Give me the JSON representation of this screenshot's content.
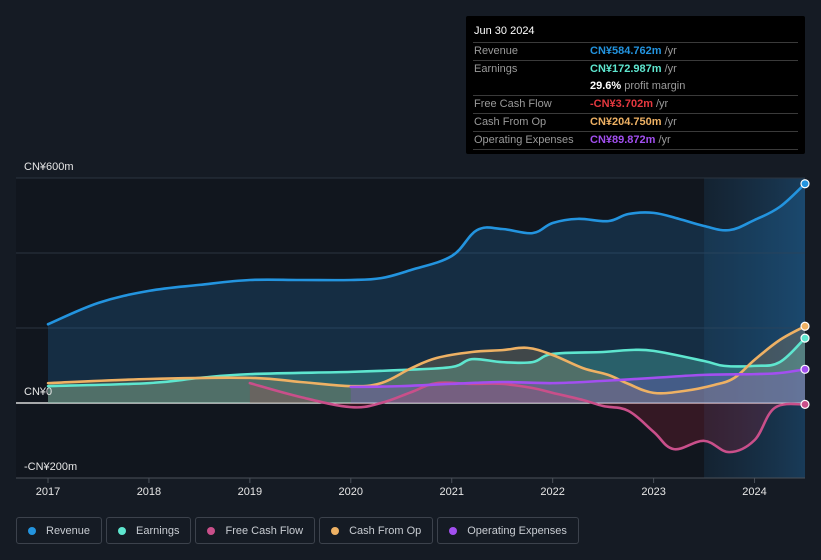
{
  "tooltip": {
    "date": "Jun 30 2024",
    "rows": [
      {
        "label": "Revenue",
        "value": "CN¥584.762m",
        "unit": "/yr",
        "color": "#2394df"
      },
      {
        "label": "Earnings",
        "value": "CN¥172.987m",
        "unit": "/yr",
        "color": "#5ee6cf"
      },
      {
        "label": "",
        "value": "29.6%",
        "unit": "profit margin",
        "color": "#ffffff"
      },
      {
        "label": "Free Cash Flow",
        "value": "-CN¥3.702m",
        "unit": "/yr",
        "color": "#e5383f"
      },
      {
        "label": "Cash From Op",
        "value": "CN¥204.750m",
        "unit": "/yr",
        "color": "#eeb164"
      },
      {
        "label": "Operating Expenses",
        "value": "CN¥89.872m",
        "unit": "/yr",
        "color": "#a24ff0"
      }
    ]
  },
  "legend": [
    {
      "label": "Revenue",
      "color": "#2394df"
    },
    {
      "label": "Earnings",
      "color": "#5ee6cf"
    },
    {
      "label": "Free Cash Flow",
      "color": "#c94f8a"
    },
    {
      "label": "Cash From Op",
      "color": "#eeb164"
    },
    {
      "label": "Operating Expenses",
      "color": "#a24ff0"
    }
  ],
  "chart_data": {
    "type": "area",
    "title": "",
    "xlabel": "",
    "ylabel": "",
    "ylim": [
      -200,
      600
    ],
    "xlim": [
      2017,
      2024.5
    ],
    "y_ticks": [
      {
        "value": 600,
        "label": "CN¥600m"
      },
      {
        "value": 0,
        "label": "CN¥0"
      },
      {
        "value": -200,
        "label": "-CN¥200m"
      }
    ],
    "x_ticks": [
      {
        "value": 2017,
        "label": "2017"
      },
      {
        "value": 2018,
        "label": "2018"
      },
      {
        "value": 2019,
        "label": "2019"
      },
      {
        "value": 2020,
        "label": "2020"
      },
      {
        "value": 2021,
        "label": "2021"
      },
      {
        "value": 2022,
        "label": "2022"
      },
      {
        "value": 2023,
        "label": "2023"
      },
      {
        "value": 2024,
        "label": "2024"
      }
    ],
    "grid": true,
    "highlight_range": [
      2023.5,
      2024.5
    ],
    "legend_position": "bottom-left",
    "series": [
      {
        "name": "Revenue",
        "color": "#2394df",
        "x": [
          2017,
          2017.5,
          2018,
          2018.5,
          2019,
          2019.5,
          2020,
          2020.3,
          2020.6,
          2021,
          2021.25,
          2021.5,
          2021.8,
          2022,
          2022.25,
          2022.55,
          2022.75,
          2023,
          2023.25,
          2023.5,
          2023.75,
          2024,
          2024.25,
          2024.5
        ],
        "values": [
          210,
          267,
          299,
          315,
          328,
          328,
          328,
          333,
          355,
          392,
          461,
          464,
          453,
          480,
          491,
          485,
          504,
          507,
          491,
          472,
          461,
          488,
          523,
          584.762
        ]
      },
      {
        "name": "Earnings",
        "color": "#5ee6cf",
        "x": [
          2017,
          2018,
          2018.5,
          2019,
          2020,
          2020.5,
          2021,
          2021.2,
          2021.5,
          2021.8,
          2022,
          2022.5,
          2022.75,
          2023,
          2023.5,
          2023.7,
          2024,
          2024.25,
          2024.5
        ],
        "values": [
          45,
          53,
          67,
          77,
          83,
          88,
          96,
          117,
          109,
          109,
          131,
          136,
          141,
          139,
          112,
          99,
          99,
          109,
          172.987
        ]
      },
      {
        "name": "Free Cash Flow",
        "color": "#c94f8a",
        "x": [
          2019,
          2019.5,
          2020,
          2020.3,
          2020.6,
          2020.85,
          2021.2,
          2021.5,
          2021.8,
          2022,
          2022.3,
          2022.5,
          2022.75,
          2023,
          2023.2,
          2023.5,
          2023.75,
          2024,
          2024.2,
          2024.5
        ],
        "values": [
          53,
          16,
          -11,
          0,
          29,
          53,
          51,
          51,
          40,
          27,
          8,
          -8,
          -21,
          -77,
          -123,
          -101,
          -131,
          -99,
          -13,
          -3.702
        ]
      },
      {
        "name": "Cash From Op",
        "color": "#eeb164",
        "x": [
          2017,
          2018,
          2019,
          2019.5,
          2020,
          2020.3,
          2020.6,
          2020.85,
          2021.2,
          2021.5,
          2021.75,
          2022,
          2022.3,
          2022.55,
          2022.75,
          2023,
          2023.3,
          2023.6,
          2023.8,
          2024,
          2024.25,
          2024.5
        ],
        "values": [
          53,
          64,
          67,
          56,
          45,
          53,
          93,
          120,
          136,
          141,
          147,
          128,
          93,
          75,
          51,
          27,
          32,
          48,
          67,
          115,
          168,
          204.75
        ]
      },
      {
        "name": "Operating Expenses",
        "color": "#a24ff0",
        "x": [
          2020,
          2020.5,
          2021,
          2021.5,
          2022,
          2022.5,
          2023,
          2023.5,
          2024,
          2024.25,
          2024.5
        ],
        "values": [
          43,
          45,
          51,
          56,
          53,
          59,
          67,
          75,
          77,
          80,
          89.872
        ]
      }
    ]
  }
}
